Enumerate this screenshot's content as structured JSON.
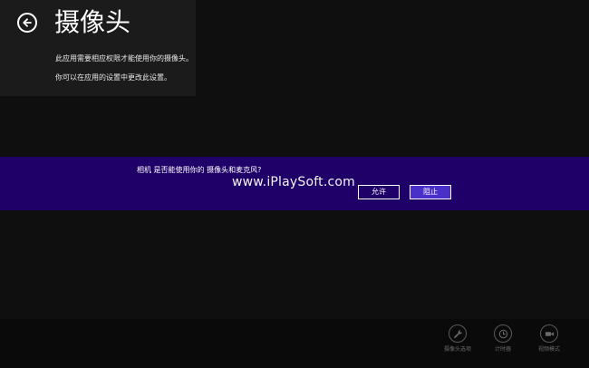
{
  "panel": {
    "title": "摄像头",
    "description_line1": "此应用需要相应权限才能使用你的摄像头。",
    "description_line2": "你可以在应用的设置中更改此设置。"
  },
  "prompt": {
    "question": "相机 是否能使用你的 摄像头和麦克风?",
    "allow_label": "允许",
    "block_label": "阻止"
  },
  "watermark": "www.iPlaySoft.com",
  "app_bar": {
    "commands": [
      {
        "label": "摄像头选项",
        "icon": "wrench-icon"
      },
      {
        "label": "计时器",
        "icon": "clock-icon"
      },
      {
        "label": "视频模式",
        "icon": "video-camera-icon"
      }
    ]
  },
  "colors": {
    "background": "#0f0f0f",
    "side_panel": "#1b1b1b",
    "prompt_band": "#1f0068",
    "block_button": "#4a2fc8"
  }
}
